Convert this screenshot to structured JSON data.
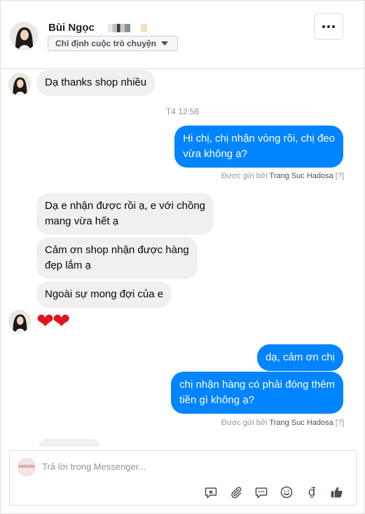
{
  "header": {
    "contact_name": "Bùi Ngọc",
    "assign_label": "Chỉ định cuộc trò chuyện"
  },
  "messages": {
    "m1": "Dạ thanks shop nhiều",
    "timestamp": "T4 12:56",
    "m2_line1": "Hi chị, chị nhận vòng rồi, chị đeo",
    "m2_line2": "vừa không ạ?",
    "sent_by_1_prefix": "Được gửi bởi",
    "sent_by_1_sender": "Trang Suc Hadosa",
    "sent_by_1_help": "[?]",
    "m3_line1": "Dạ e nhận được rồi ạ, e với chồng",
    "m3_line2": "mang vừa hết ạ",
    "m4_line1": "Cảm ơn shop nhận được hàng",
    "m4_line2": "đẹp lắm ạ",
    "m5": "Ngoài sự mong đợi của e",
    "m6": "❤❤",
    "m7": "dạ, cảm ơn chị",
    "m8_line1": "chị nhận hàng có phải đóng thêm",
    "m8_line2": "tiền gì không ạ?",
    "sent_by_2_prefix": "Được gửi bởi",
    "sent_by_2_sender": "Trang Suc Hadosa",
    "sent_by_2_help": "[?]"
  },
  "composer": {
    "placeholder": "Trả lời trong Messenger...",
    "page_logo_text": "HADOSA",
    "currency_symbol": "₫"
  },
  "colors": {
    "outgoing_bubble": "#0084ff",
    "incoming_bubble": "#f0f0f0",
    "like_icon": "#4b4f56"
  },
  "icons": [
    "more-icon",
    "chevron-down-icon",
    "saved-reply-icon",
    "attach-icon",
    "chat-icon",
    "emoji-icon",
    "currency-icon",
    "thumbs-up-icon"
  ]
}
